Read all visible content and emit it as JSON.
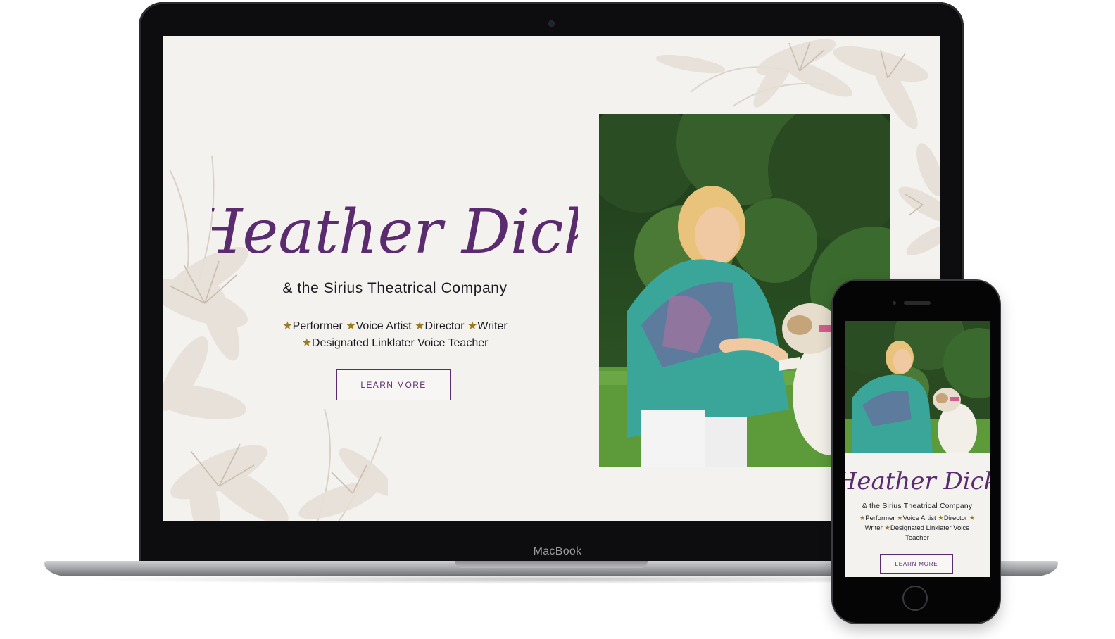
{
  "laptop": {
    "brand_label": "MacBook"
  },
  "site": {
    "title": "Heather Dick",
    "subtitle": "& the Sirius Theatrical Company",
    "star": "★",
    "roles_line1": [
      "Performer",
      "Voice Artist",
      "Director",
      "Writer"
    ],
    "roles_line2": [
      "Designated Linklater Voice Teacher"
    ],
    "cta_label": "LEARN MORE"
  },
  "mobile": {
    "title": "Heather Dick",
    "subtitle": "& the Sirius Theatrical Company",
    "roles_line1": [
      "Performer",
      "Voice Artist",
      "Director"
    ],
    "roles_line2": [
      "Writer",
      "Designated Linklater Voice"
    ],
    "roles_line3": "Teacher",
    "cta_label": "LEARN MORE"
  },
  "colors": {
    "brand_purple": "#5a2b6f",
    "star_gold": "#9a7b1e",
    "page_background": "#f4f2ef"
  }
}
